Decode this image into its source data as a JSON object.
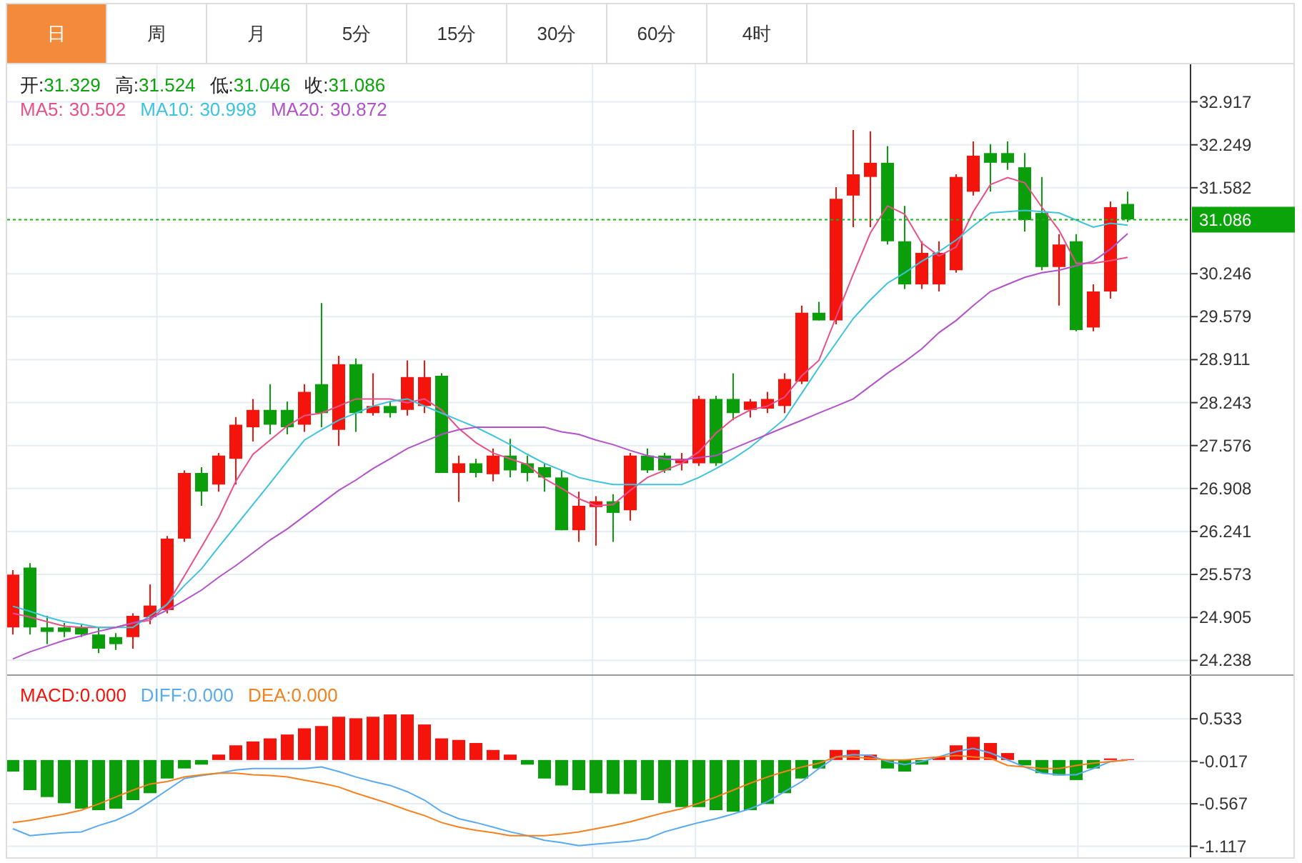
{
  "tabs": [
    {
      "label": "日",
      "selected": true
    },
    {
      "label": "周",
      "selected": false
    },
    {
      "label": "月",
      "selected": false
    },
    {
      "label": "5分",
      "selected": false
    },
    {
      "label": "15分",
      "selected": false
    },
    {
      "label": "30分",
      "selected": false
    },
    {
      "label": "60分",
      "selected": false
    },
    {
      "label": "4时",
      "selected": false
    }
  ],
  "price_chart": {
    "legend_ohlc": [
      {
        "label": "开:",
        "value": "31.329"
      },
      {
        "label": "高:",
        "value": "31.524"
      },
      {
        "label": "低:",
        "value": "31.046"
      },
      {
        "label": "收:",
        "value": "31.086"
      }
    ],
    "legend_ma": [
      {
        "value": "30.502"
      },
      {
        "value": "30.998"
      },
      {
        "value": "30.872"
      }
    ],
    "chart_data": {
      "type": "candlestick",
      "ylim": [
        24.02,
        33.5
      ],
      "grid": true,
      "ref_lines": [
        {
          "axis": "y",
          "value": 31.086,
          "label": "31.086",
          "color": "#19b419"
        }
      ],
      "yticks": [
        32.917,
        32.249,
        31.582,
        30.246,
        29.579,
        28.911,
        28.243,
        27.576,
        26.908,
        26.241,
        25.573,
        24.905,
        24.238
      ],
      "series": [
        {
          "name": "MA5:",
          "type": "line",
          "color": "#e8508c",
          "values": [
            24.97,
            24.91,
            24.84,
            24.77,
            24.75,
            24.75,
            24.75,
            24.82,
            24.86,
            25.11,
            25.55,
            26.0,
            26.46,
            27.02,
            27.44,
            27.66,
            27.88,
            28.04,
            28.08,
            28.19,
            28.3,
            28.3,
            28.3,
            28.24,
            28.3,
            28.13,
            27.84,
            27.62,
            27.46,
            27.37,
            27.28,
            27.06,
            26.91,
            26.75,
            26.64,
            26.66,
            26.88,
            27.08,
            27.19,
            27.3,
            27.48,
            27.77,
            27.99,
            28.13,
            28.19,
            28.33,
            28.66,
            28.9,
            29.57,
            30.24,
            30.88,
            31.3,
            31.17,
            30.72,
            30.52,
            30.66,
            31.21,
            31.63,
            31.74,
            31.66,
            31.28,
            30.92,
            30.41,
            30.41,
            30.45,
            30.5
          ]
        },
        {
          "name": "MA10:",
          "type": "line",
          "color": "#3ec3dd",
          "values": [
            25.08,
            25.0,
            24.91,
            24.84,
            24.8,
            24.75,
            24.75,
            24.75,
            24.93,
            25.11,
            25.4,
            25.66,
            26.0,
            26.33,
            26.66,
            26.99,
            27.33,
            27.66,
            27.82,
            27.97,
            28.08,
            28.19,
            28.26,
            28.3,
            28.19,
            28.08,
            27.97,
            27.86,
            27.73,
            27.59,
            27.44,
            27.3,
            27.19,
            27.08,
            27.02,
            26.97,
            26.97,
            26.97,
            26.97,
            26.97,
            27.08,
            27.22,
            27.37,
            27.55,
            27.77,
            27.99,
            28.39,
            28.79,
            29.17,
            29.55,
            29.84,
            30.1,
            30.26,
            30.44,
            30.59,
            30.77,
            30.99,
            31.19,
            31.21,
            31.23,
            31.21,
            31.19,
            31.08,
            30.97,
            31.03,
            31.0
          ]
        },
        {
          "name": "MA20:",
          "type": "line",
          "color": "#b352c8",
          "values": [
            24.26,
            24.37,
            24.46,
            24.55,
            24.62,
            24.69,
            24.75,
            24.82,
            24.89,
            25.02,
            25.17,
            25.33,
            25.53,
            25.71,
            25.91,
            26.11,
            26.28,
            26.48,
            26.68,
            26.88,
            27.04,
            27.22,
            27.37,
            27.53,
            27.64,
            27.75,
            27.82,
            27.86,
            27.86,
            27.86,
            27.86,
            27.86,
            27.79,
            27.75,
            27.66,
            27.59,
            27.5,
            27.42,
            27.37,
            27.35,
            27.39,
            27.42,
            27.53,
            27.64,
            27.75,
            27.86,
            27.97,
            28.08,
            28.19,
            28.3,
            28.5,
            28.7,
            28.88,
            29.08,
            29.33,
            29.52,
            29.75,
            29.97,
            30.08,
            30.19,
            30.26,
            30.3,
            30.37,
            30.44,
            30.63,
            30.87
          ]
        }
      ],
      "ohlc": [
        [
          24.75,
          25.64,
          24.64,
          25.57
        ],
        [
          25.68,
          25.75,
          24.64,
          24.75
        ],
        [
          24.75,
          24.93,
          24.49,
          24.68
        ],
        [
          24.75,
          24.82,
          24.6,
          24.68
        ],
        [
          24.75,
          24.8,
          24.6,
          24.64
        ],
        [
          24.64,
          24.75,
          24.35,
          24.42
        ],
        [
          24.6,
          24.66,
          24.4,
          24.49
        ],
        [
          24.6,
          24.97,
          24.42,
          24.93
        ],
        [
          24.91,
          25.42,
          24.8,
          25.09
        ],
        [
          25.02,
          26.17,
          24.97,
          26.13
        ],
        [
          26.13,
          27.19,
          26.08,
          27.15
        ],
        [
          27.15,
          27.24,
          26.64,
          26.86
        ],
        [
          26.97,
          27.46,
          26.86,
          27.42
        ],
        [
          27.37,
          28.02,
          26.97,
          27.9
        ],
        [
          27.86,
          28.3,
          27.64,
          28.13
        ],
        [
          28.13,
          28.53,
          27.75,
          27.9
        ],
        [
          28.13,
          28.26,
          27.75,
          27.86
        ],
        [
          27.9,
          28.53,
          27.79,
          28.41
        ],
        [
          28.53,
          29.79,
          27.86,
          28.08
        ],
        [
          27.82,
          28.97,
          27.57,
          28.84
        ],
        [
          28.84,
          28.93,
          27.79,
          28.08
        ],
        [
          28.08,
          28.7,
          28.04,
          28.19
        ],
        [
          28.19,
          28.26,
          28.01,
          28.08
        ],
        [
          28.13,
          28.9,
          28.04,
          28.64
        ],
        [
          28.19,
          28.9,
          28.08,
          28.64
        ],
        [
          28.66,
          28.7,
          27.15,
          27.15
        ],
        [
          27.15,
          27.42,
          26.7,
          27.3
        ],
        [
          27.3,
          27.37,
          27.08,
          27.15
        ],
        [
          27.13,
          27.53,
          27.02,
          27.42
        ],
        [
          27.42,
          27.68,
          27.08,
          27.19
        ],
        [
          27.3,
          27.42,
          27.02,
          27.15
        ],
        [
          27.24,
          27.3,
          26.86,
          27.08
        ],
        [
          27.08,
          27.19,
          26.26,
          26.26
        ],
        [
          26.26,
          26.86,
          26.08,
          26.64
        ],
        [
          26.62,
          26.79,
          26.02,
          26.71
        ],
        [
          26.71,
          26.82,
          26.08,
          26.53
        ],
        [
          26.57,
          27.46,
          26.41,
          27.42
        ],
        [
          27.42,
          27.53,
          27.15,
          27.19
        ],
        [
          27.42,
          27.46,
          27.15,
          27.19
        ],
        [
          27.3,
          27.46,
          27.19,
          27.37
        ],
        [
          27.3,
          28.35,
          27.26,
          28.3
        ],
        [
          28.3,
          28.35,
          27.26,
          27.3
        ],
        [
          28.3,
          28.7,
          27.97,
          28.08
        ],
        [
          28.13,
          28.3,
          28.01,
          28.26
        ],
        [
          28.15,
          28.41,
          28.08,
          28.3
        ],
        [
          28.19,
          28.7,
          28.08,
          28.61
        ],
        [
          28.57,
          29.75,
          28.53,
          29.64
        ],
        [
          29.64,
          29.81,
          29.52,
          29.52
        ],
        [
          29.52,
          31.59,
          29.46,
          31.41
        ],
        [
          31.46,
          32.48,
          30.97,
          31.79
        ],
        [
          31.75,
          32.46,
          30.97,
          31.97
        ],
        [
          31.97,
          32.23,
          30.7,
          30.75
        ],
        [
          30.75,
          31.3,
          30.01,
          30.08
        ],
        [
          30.08,
          30.75,
          30.01,
          30.57
        ],
        [
          30.08,
          30.75,
          29.97,
          30.57
        ],
        [
          30.3,
          31.79,
          30.26,
          31.75
        ],
        [
          31.52,
          32.3,
          31.46,
          32.08
        ],
        [
          32.12,
          32.26,
          31.52,
          31.97
        ],
        [
          32.12,
          32.3,
          31.86,
          31.97
        ],
        [
          31.9,
          32.12,
          30.9,
          31.08
        ],
        [
          31.19,
          31.75,
          30.3,
          30.35
        ],
        [
          30.35,
          30.86,
          29.75,
          30.7
        ],
        [
          30.75,
          30.86,
          29.35,
          29.37
        ],
        [
          29.41,
          30.08,
          29.35,
          29.97
        ],
        [
          29.97,
          31.37,
          29.86,
          31.28
        ],
        [
          31.33,
          31.52,
          31.05,
          31.09
        ]
      ]
    }
  },
  "macd_chart": {
    "legend": [
      {
        "value": "0.000"
      },
      {
        "value": "0.000"
      },
      {
        "value": "0.000"
      }
    ],
    "chart_data": {
      "type": "bar",
      "ylim": [
        -1.26,
        1.09
      ],
      "grid": true,
      "yticks": [
        0.533,
        -0.017,
        -0.567,
        -1.117
      ],
      "series": [
        {
          "name": "MACD:",
          "type": "bar",
          "color": "#f5140c",
          "colors": [
            "#0a9e0a",
            "#0a9e0a",
            "#0a9e0a",
            "#0a9e0a",
            "#0a9e0a",
            "#0a9e0a",
            "#0a9e0a",
            "#0a9e0a",
            "#0a9e0a",
            "#0a9e0a",
            "#0a9e0a",
            "#0a9e0a",
            "#f5140c",
            "#f5140c",
            "#f5140c",
            "#f5140c",
            "#f5140c",
            "#f5140c",
            "#f5140c",
            "#f5140c",
            "#f5140c",
            "#f5140c",
            "#f5140c",
            "#f5140c",
            "#f5140c",
            "#f5140c",
            "#f5140c",
            "#f5140c",
            "#f5140c",
            "#f5140c",
            "#0a9e0a",
            "#0a9e0a",
            "#0a9e0a",
            "#0a9e0a",
            "#0a9e0a",
            "#0a9e0a",
            "#0a9e0a",
            "#0a9e0a",
            "#0a9e0a",
            "#0a9e0a",
            "#0a9e0a",
            "#0a9e0a",
            "#0a9e0a",
            "#0a9e0a",
            "#0a9e0a",
            "#0a9e0a",
            "#0a9e0a",
            "#0a9e0a",
            "#f5140c",
            "#f5140c",
            "#f5140c",
            "#0a9e0a",
            "#0a9e0a",
            "#0a9e0a",
            "#f5140c",
            "#f5140c",
            "#f5140c",
            "#f5140c",
            "#f5140c",
            "#0a9e0a",
            "#0a9e0a",
            "#0a9e0a",
            "#0a9e0a",
            "#0a9e0a",
            "#f5140c",
            "#f5140c"
          ],
          "values": [
            -0.15,
            -0.39,
            -0.48,
            -0.56,
            -0.63,
            -0.65,
            -0.63,
            -0.52,
            -0.43,
            -0.24,
            -0.11,
            -0.06,
            0.07,
            0.19,
            0.24,
            0.28,
            0.33,
            0.41,
            0.44,
            0.56,
            0.54,
            0.56,
            0.59,
            0.59,
            0.46,
            0.28,
            0.26,
            0.22,
            0.13,
            0.07,
            -0.06,
            -0.24,
            -0.33,
            -0.39,
            -0.43,
            -0.44,
            -0.44,
            -0.52,
            -0.56,
            -0.61,
            -0.61,
            -0.65,
            -0.67,
            -0.65,
            -0.57,
            -0.43,
            -0.24,
            -0.11,
            0.13,
            0.13,
            0.07,
            -0.11,
            -0.15,
            -0.06,
            0.04,
            0.19,
            0.3,
            0.22,
            0.09,
            -0.07,
            -0.17,
            -0.2,
            -0.26,
            -0.11,
            0.02,
            0.01
          ]
        },
        {
          "name": "DIFF:",
          "type": "line",
          "color": "#5aaaf0",
          "values": [
            -0.89,
            -0.98,
            -0.96,
            -0.94,
            -0.93,
            -0.85,
            -0.78,
            -0.68,
            -0.54,
            -0.39,
            -0.24,
            -0.2,
            -0.17,
            -0.13,
            -0.11,
            -0.11,
            -0.11,
            -0.11,
            -0.09,
            -0.15,
            -0.22,
            -0.28,
            -0.33,
            -0.41,
            -0.52,
            -0.67,
            -0.76,
            -0.81,
            -0.87,
            -0.93,
            -0.98,
            -1.04,
            -1.07,
            -1.11,
            -1.09,
            -1.07,
            -1.05,
            -1.02,
            -0.93,
            -0.87,
            -0.81,
            -0.76,
            -0.7,
            -0.63,
            -0.54,
            -0.41,
            -0.28,
            -0.11,
            0.04,
            0.07,
            0.06,
            -0.02,
            -0.06,
            -0.02,
            0.04,
            0.11,
            0.15,
            0.09,
            0,
            -0.09,
            -0.17,
            -0.19,
            -0.19,
            -0.11,
            -0.02,
            0
          ]
        },
        {
          "name": "DEA:",
          "type": "line",
          "color": "#f5801e",
          "values": [
            -0.81,
            -0.78,
            -0.74,
            -0.7,
            -0.65,
            -0.57,
            -0.48,
            -0.39,
            -0.31,
            -0.28,
            -0.22,
            -0.19,
            -0.17,
            -0.17,
            -0.19,
            -0.2,
            -0.22,
            -0.26,
            -0.3,
            -0.35,
            -0.43,
            -0.5,
            -0.57,
            -0.65,
            -0.72,
            -0.81,
            -0.87,
            -0.91,
            -0.94,
            -0.98,
            -0.98,
            -0.98,
            -0.96,
            -0.93,
            -0.89,
            -0.85,
            -0.8,
            -0.74,
            -0.68,
            -0.63,
            -0.56,
            -0.48,
            -0.39,
            -0.3,
            -0.22,
            -0.15,
            -0.09,
            -0.04,
            0.04,
            0.04,
            0.02,
            0,
            0,
            0.02,
            0.04,
            0.06,
            0.04,
            0.02,
            -0.07,
            -0.09,
            -0.11,
            -0.11,
            -0.07,
            -0.04,
            -0.02,
            0
          ]
        }
      ]
    }
  }
}
